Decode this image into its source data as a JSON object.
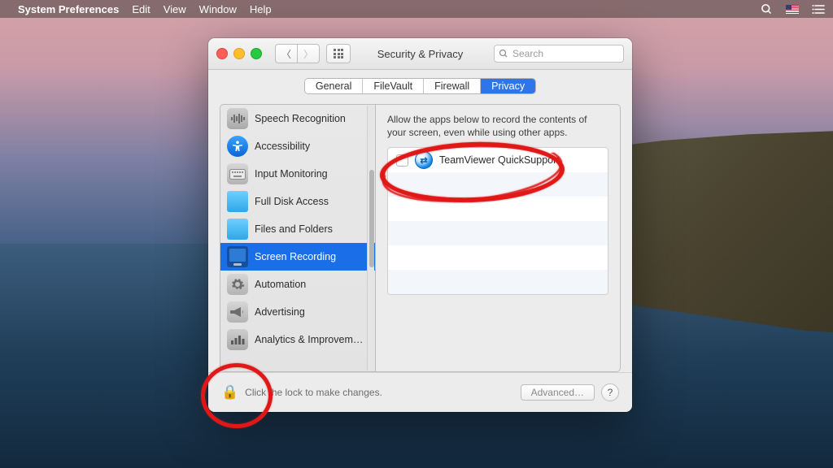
{
  "menubar": {
    "app": "System Preferences",
    "items": [
      "Edit",
      "View",
      "Window",
      "Help"
    ]
  },
  "window": {
    "title": "Security & Privacy",
    "search_placeholder": "Search",
    "tabs": [
      "General",
      "FileVault",
      "Firewall",
      "Privacy"
    ],
    "active_tab": "Privacy"
  },
  "sidebar": {
    "items": [
      {
        "label": "Speech Recognition",
        "icon": "waveform"
      },
      {
        "label": "Accessibility",
        "icon": "accessibility"
      },
      {
        "label": "Input Monitoring",
        "icon": "keyboard"
      },
      {
        "label": "Full Disk Access",
        "icon": "folder"
      },
      {
        "label": "Files and Folders",
        "icon": "folder"
      },
      {
        "label": "Screen Recording",
        "icon": "monitor",
        "selected": true
      },
      {
        "label": "Automation",
        "icon": "gear"
      },
      {
        "label": "Advertising",
        "icon": "megaphone"
      },
      {
        "label": "Analytics & Improvem…",
        "icon": "bars"
      }
    ]
  },
  "content": {
    "description": "Allow the apps below to record the contents of your screen, even while using other apps.",
    "apps": [
      {
        "name": "TeamViewer QuickSupport",
        "checked": false
      }
    ]
  },
  "footer": {
    "lock_text": "Click the lock to make changes.",
    "advanced": "Advanced…"
  }
}
